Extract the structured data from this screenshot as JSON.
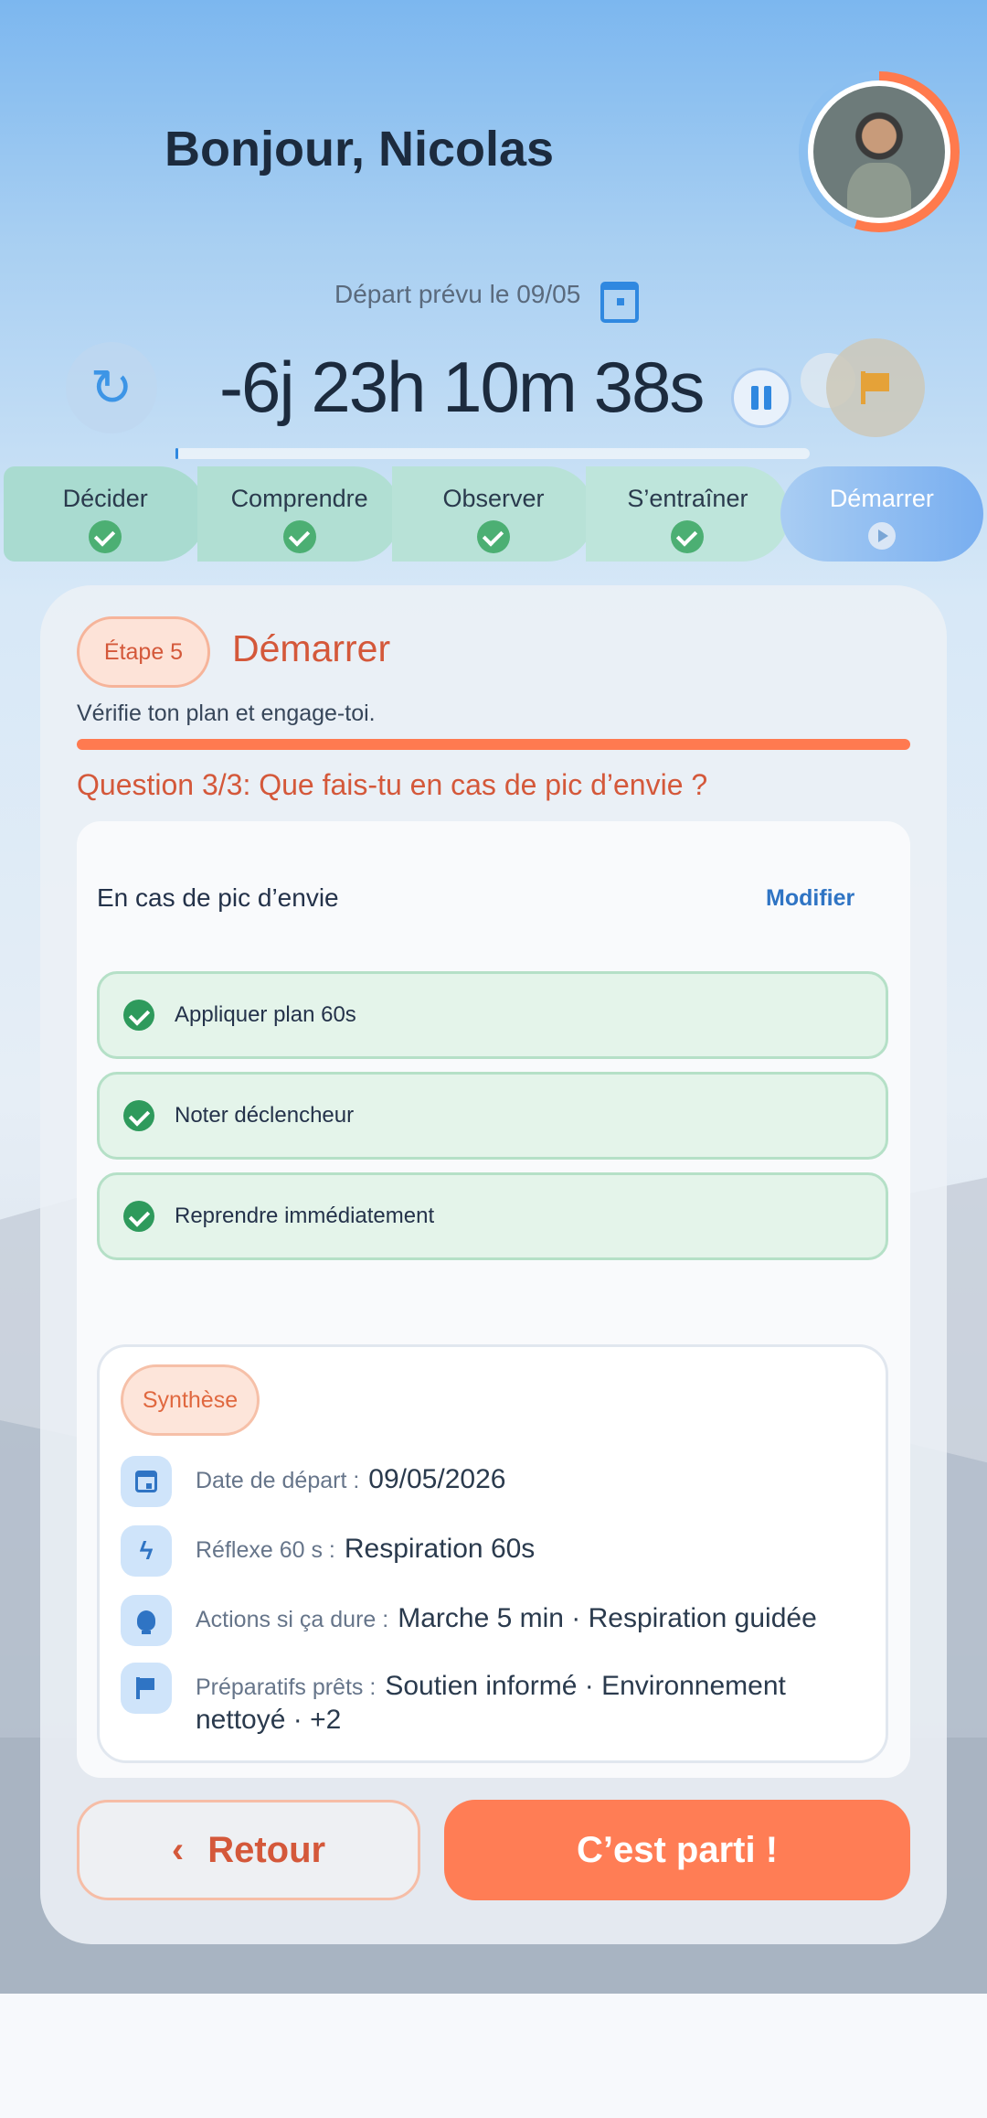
{
  "header": {
    "greeting": "Bonjour, Nicolas"
  },
  "countdown": {
    "depart_label": "Départ prévu le 09/05",
    "time": "-6j 23h 10m 38s",
    "progress": 0.005
  },
  "steps": [
    {
      "label": "Décider",
      "done": true
    },
    {
      "label": "Comprendre",
      "done": true
    },
    {
      "label": "Observer",
      "done": true
    },
    {
      "label": "S’entraîner",
      "done": true
    },
    {
      "label": "Démarrer",
      "done": false,
      "active": true
    }
  ],
  "card": {
    "step_badge": "Étape 5",
    "title": "Démarrer",
    "subtitle": "Vérifie ton plan et engage-toi.",
    "question": "Question 3/3: Que fais-tu en cas de pic d’envie ?",
    "section_title": "En cas de pic d’envie",
    "modify_label": "Modifier",
    "options": [
      "Appliquer plan 60s",
      "Noter déclencheur",
      "Reprendre immédiatement"
    ],
    "summary": {
      "badge": "Synthèse",
      "rows": [
        {
          "icon": "calendar-icon",
          "label": "Date de départ :",
          "value": "09/05/2026"
        },
        {
          "icon": "bolt-icon",
          "label": "Réflexe 60 s :",
          "value": "Respiration 60s"
        },
        {
          "icon": "lightbulb-icon",
          "label": "Actions si ça dure :",
          "value": "Marche 5 min · Respiration guidée"
        },
        {
          "icon": "flag-icon",
          "label": "Préparatifs prêts :",
          "value": "Soutien informé · Environnement nettoyé · +2"
        }
      ]
    }
  },
  "buttons": {
    "back_icon": "‹",
    "back": "Retour",
    "go": "C’est parti !"
  },
  "colors": {
    "accent": "#ff7a50",
    "primary": "#2f88e0",
    "success": "#2e9a5c"
  }
}
